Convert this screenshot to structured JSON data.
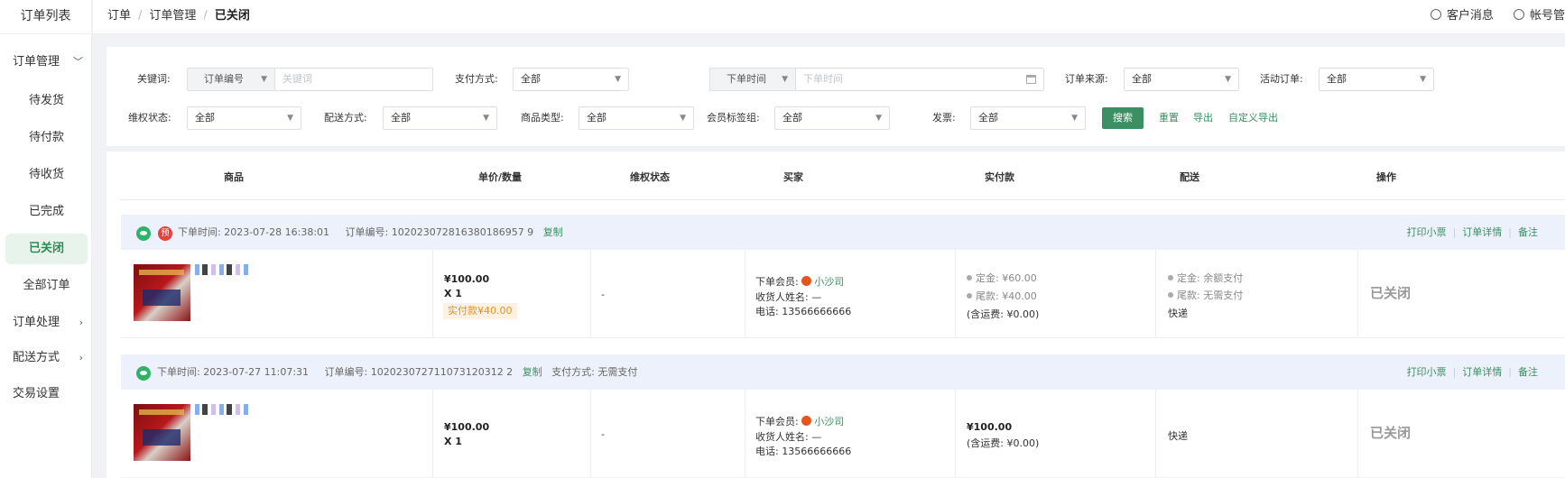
{
  "sidebar": {
    "title": "订单列表",
    "groups": [
      {
        "label": "订单管理",
        "chevron": "﹀"
      },
      {
        "label": "订单处理",
        "chevron": "›"
      },
      {
        "label": "配送方式",
        "chevron": "›"
      },
      {
        "label": "交易设置",
        "chevron": ""
      }
    ],
    "items": [
      "待发货",
      "待付款",
      "待收货",
      "已完成",
      "已关闭",
      "全部订单"
    ],
    "active_item": "已关闭"
  },
  "header": {
    "breadcrumb": [
      "订单",
      "订单管理",
      "已关闭"
    ],
    "customer_msg": "客户消息",
    "account": "帐号管"
  },
  "filters": {
    "keyword_label": "关键词:",
    "keyword_type": "订单编号",
    "keyword_placeholder": "关键词",
    "pay_method_label": "支付方式:",
    "pay_method_value": "全部",
    "time_type": "下单时间",
    "time_placeholder": "下单时间",
    "source_label": "订单来源:",
    "source_value": "全部",
    "activity_label": "活动订单:",
    "activity_value": "全部",
    "rights_label": "维权状态:",
    "rights_value": "全部",
    "delivery_label": "配送方式:",
    "delivery_value": "全部",
    "goods_type_label": "商品类型:",
    "goods_type_value": "全部",
    "member_tag_label": "会员标签组:",
    "member_tag_value": "全部",
    "invoice_label": "发票:",
    "invoice_value": "全部",
    "search_btn": "搜索",
    "reset_link": "重置",
    "export_link": "导出",
    "custom_export_link": "自定义导出"
  },
  "table": {
    "columns": [
      "商品",
      "单价/数量",
      "维权状态",
      "买家",
      "实付款",
      "配送",
      "操作"
    ]
  },
  "orders": [
    {
      "time": "下单时间: 2023-07-28 16:38:01",
      "order_no": "订单编号: 102023072816380186957 9",
      "copy": "复制",
      "pay_method": "",
      "badge": "预",
      "actions": [
        "打印小票",
        "订单详情",
        "备注"
      ],
      "price": "¥100.00",
      "qty": "X 1",
      "paid_tag": "实付款¥40.00",
      "rights": "-",
      "member_label": "下单会员:",
      "member_name": "小沙司",
      "receiver": "收货人姓名: —",
      "phone": "电话: 13566666666",
      "pay_lines": [
        "定金: ¥60.00",
        "尾款: ¥40.00"
      ],
      "shipping_fee": "(含运费: ¥0.00)",
      "deliv_lines": [
        "定金: 余额支付",
        "尾款: 无需支付"
      ],
      "delivery": "快递",
      "status": "已关闭"
    },
    {
      "time": "下单时间: 2023-07-27 11:07:31",
      "order_no": "订单编号: 102023072711073120312 2",
      "copy": "复制",
      "pay_method": "支付方式: 无需支付",
      "badge": "",
      "actions": [
        "打印小票",
        "订单详情",
        "备注"
      ],
      "price": "¥100.00",
      "qty": "X 1",
      "paid_tag": "",
      "rights": "-",
      "member_label": "下单会员:",
      "member_name": "小沙司",
      "receiver": "收货人姓名: —",
      "phone": "电话: 13566666666",
      "pay_amount": "¥100.00",
      "shipping_fee": "(含运费: ¥0.00)",
      "delivery": "快递",
      "status": "已关闭"
    }
  ]
}
